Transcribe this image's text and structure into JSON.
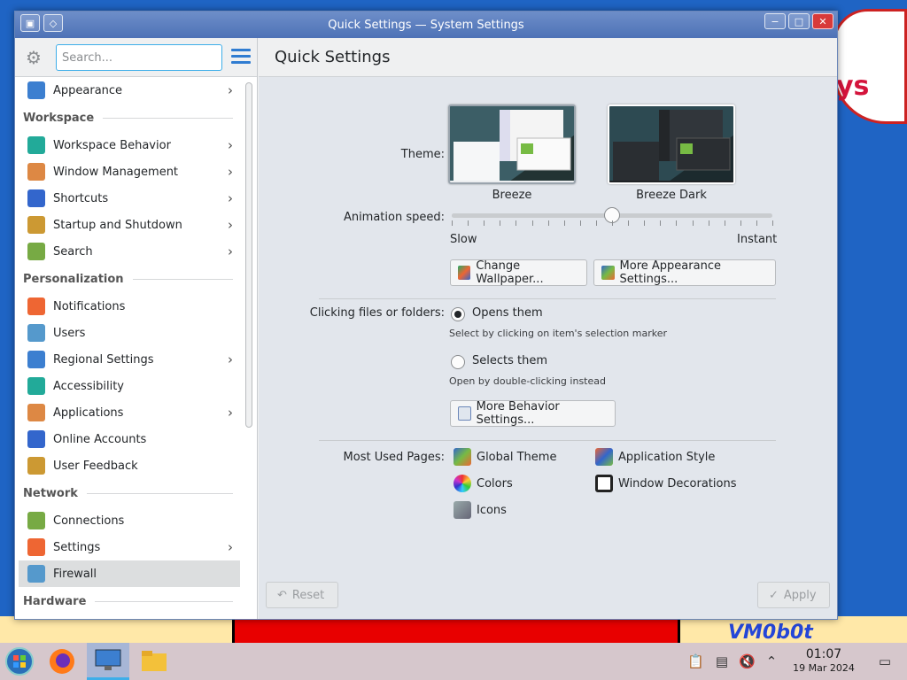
{
  "window": {
    "title": "Quick Settings — System Settings"
  },
  "sidebar": {
    "search_placeholder": "Search...",
    "items": [
      {
        "label": "Appearance",
        "icon": "appearance-icon",
        "chevron": true
      },
      {
        "category": "Workspace"
      },
      {
        "label": "Workspace Behavior",
        "icon": "workspace-behavior-icon",
        "chevron": true
      },
      {
        "label": "Window Management",
        "icon": "window-management-icon",
        "chevron": true
      },
      {
        "label": "Shortcuts",
        "icon": "shortcuts-icon",
        "chevron": true
      },
      {
        "label": "Startup and Shutdown",
        "icon": "startup-icon",
        "chevron": true
      },
      {
        "label": "Search",
        "icon": "search-icon",
        "chevron": true
      },
      {
        "category": "Personalization"
      },
      {
        "label": "Notifications",
        "icon": "bell-icon",
        "chevron": false
      },
      {
        "label": "Users",
        "icon": "users-icon",
        "chevron": false
      },
      {
        "label": "Regional Settings",
        "icon": "globe-icon",
        "chevron": true
      },
      {
        "label": "Accessibility",
        "icon": "accessibility-icon",
        "chevron": false
      },
      {
        "label": "Applications",
        "icon": "applications-icon",
        "chevron": true
      },
      {
        "label": "Online Accounts",
        "icon": "online-accounts-icon",
        "chevron": false
      },
      {
        "label": "User Feedback",
        "icon": "feedback-icon",
        "chevron": false
      },
      {
        "category": "Network"
      },
      {
        "label": "Connections",
        "icon": "connections-icon",
        "chevron": false
      },
      {
        "label": "Settings",
        "icon": "network-settings-icon",
        "chevron": true
      },
      {
        "label": "Firewall",
        "icon": "firewall-icon",
        "chevron": false,
        "active": true
      },
      {
        "category": "Hardware"
      }
    ]
  },
  "main": {
    "title": "Quick Settings",
    "theme_label": "Theme:",
    "themes": [
      {
        "name": "Breeze",
        "selected": true
      },
      {
        "name": "Breeze Dark",
        "selected": false
      }
    ],
    "animation_label": "Animation speed:",
    "animation_min": "Slow",
    "animation_max": "Instant",
    "animation_value": 0.5,
    "change_wallpaper": "Change Wallpaper...",
    "more_appearance": "More Appearance Settings...",
    "clicking_label": "Clicking files or folders:",
    "opens_them": "Opens them",
    "opens_hint": "Select by clicking on item's selection marker",
    "selects_them": "Selects them",
    "selects_hint": "Open by double-clicking instead",
    "more_behavior": "More Behavior Settings...",
    "most_used_label": "Most Used Pages:",
    "most_used": [
      {
        "label": "Global Theme",
        "icon": "global-theme-icon"
      },
      {
        "label": "Application Style",
        "icon": "application-style-icon"
      },
      {
        "label": "Colors",
        "icon": "colors-icon"
      },
      {
        "label": "Window Decorations",
        "icon": "window-decorations-icon"
      },
      {
        "label": "Icons",
        "icon": "icons-icon"
      }
    ],
    "reset": "Reset",
    "apply": "Apply"
  },
  "wallpaper": {
    "text": "ys",
    "vm_text": "VM0b0t"
  },
  "taskbar": {
    "time": "01:07",
    "date": "19 Mar 2024"
  }
}
